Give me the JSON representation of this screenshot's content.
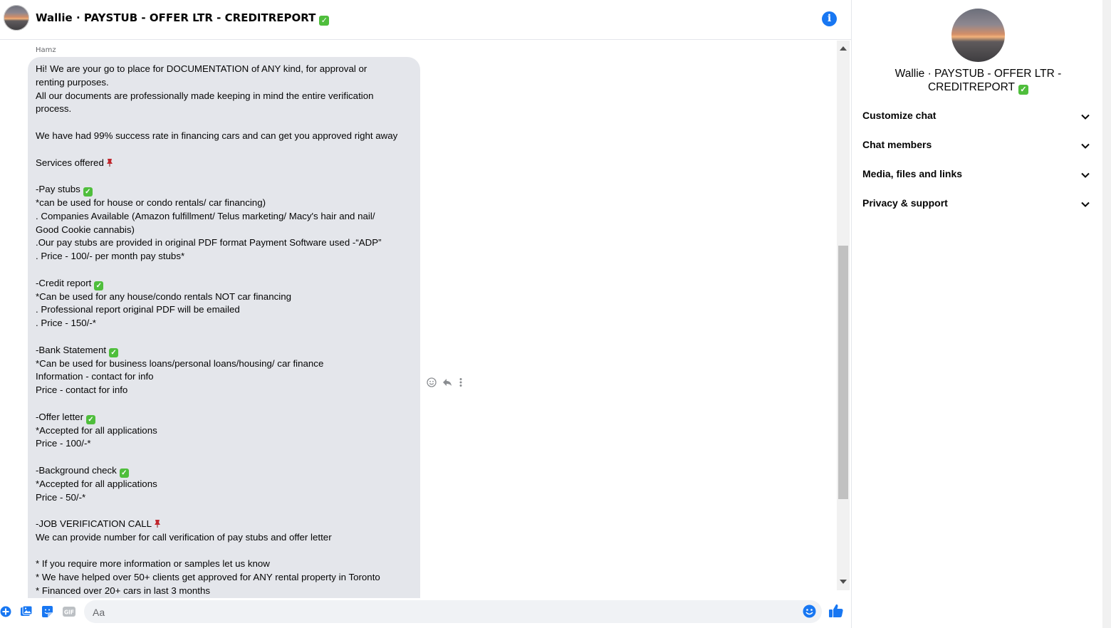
{
  "conversation": {
    "title": "Wallie · PAYSTUB - OFFER LTR - CREDITREPORT",
    "verified_badge": "✓"
  },
  "message": {
    "sender": "Hamz",
    "lines": [
      "Hi! We are your go to place for DOCUMENTATION of ANY kind, for approval or",
      "renting purposes.",
      "All our documents are professionally made keeping in mind the entire verification",
      "process.",
      "",
      "We have had 99% success rate in financing cars and can get you approved right away",
      "",
      "Services offered",
      "",
      "-Pay stubs",
      "*can be used for house or condo rentals/ car financing)",
      ". Companies Available (Amazon fulfillment/ Telus marketing/ Macy's hair and nail/",
      "Good Cookie cannabis)",
      ".Our pay stubs are provided in original PDF format Payment Software used -“ADP”",
      ". Price - 100/- per month pay stubs*",
      "",
      "-Credit report",
      "*Can be used for any house/condo rentals NOT car financing",
      ". Professional report original PDF will be emailed",
      ". Price - 150/-*",
      "",
      "-Bank Statement",
      "*Can be used for business loans/personal loans/housing/ car finance",
      "Information - contact for info",
      "Price - contact for info",
      "",
      "-Offer letter",
      "*Accepted for all applications",
      "Price - 100/-*",
      "",
      "-Background check",
      "*Accepted for all applications",
      "Price - 50/-*",
      "",
      "-JOB VERIFICATION CALL",
      "We can provide number for call verification of pay stubs and offer letter",
      "",
      "* If you require more information or samples let us know",
      "* We have helped over 50+ clients get approved for ANY rental property in Toronto",
      "* Financed over 20+ cars in last 3 months"
    ],
    "check_lines": [
      9,
      16,
      21,
      26,
      30
    ],
    "pin_lines": [
      7,
      34
    ]
  },
  "composer": {
    "placeholder": "Aa"
  },
  "icons": {
    "add": "plus-circle-icon",
    "image": "image-icon",
    "sticker": "sticker-icon",
    "gif": "gif-icon",
    "emoji": "smiley-icon",
    "like": "thumbs-up-icon",
    "info": "info-icon"
  },
  "sidebar": {
    "title": "Wallie · PAYSTUB - OFFER LTR - CREDITREPORT",
    "sections": [
      {
        "label": "Customize chat"
      },
      {
        "label": "Chat members"
      },
      {
        "label": "Media, files and links"
      },
      {
        "label": "Privacy & support"
      }
    ]
  },
  "colors": {
    "accent": "#1877f2",
    "bubble": "#e4e6eb",
    "check": "#4fbe3c",
    "pin": "#c1272d"
  }
}
